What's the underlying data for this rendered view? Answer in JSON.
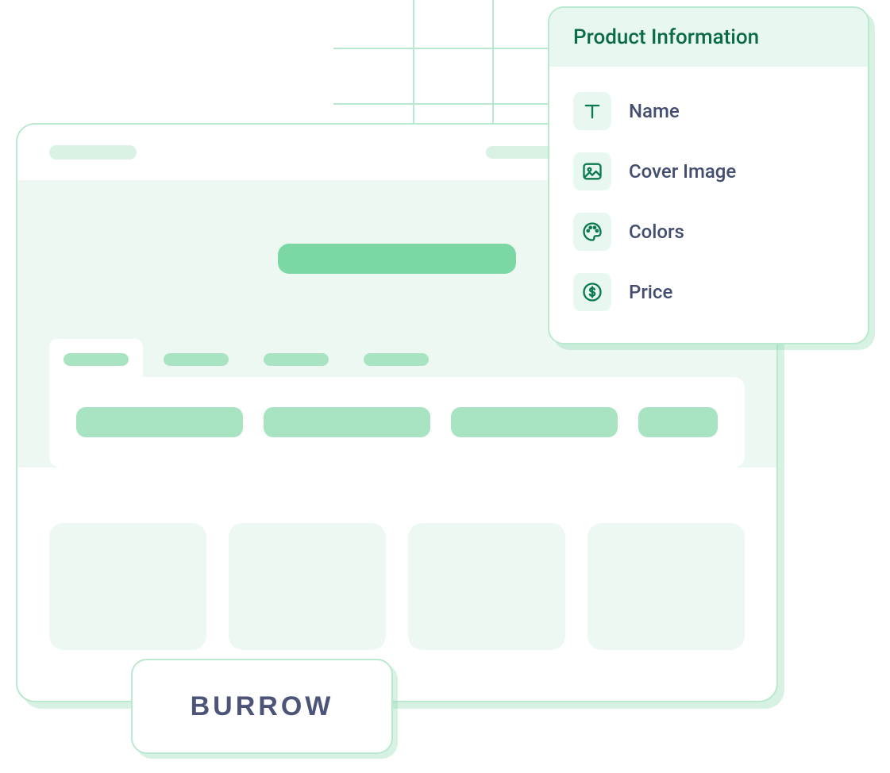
{
  "brand": {
    "name": "BURROW"
  },
  "info_panel": {
    "title": "Product Information",
    "fields": [
      {
        "icon": "text-icon",
        "label": "Name"
      },
      {
        "icon": "image-icon",
        "label": "Cover Image"
      },
      {
        "icon": "palette-icon",
        "label": "Colors"
      },
      {
        "icon": "dollar-icon",
        "label": "Price"
      }
    ]
  }
}
